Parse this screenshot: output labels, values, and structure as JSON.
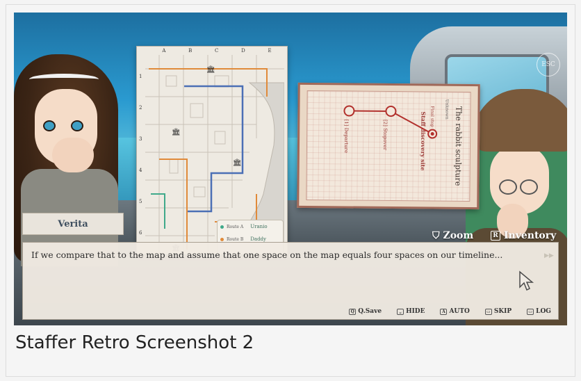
{
  "esc_label": "ESC",
  "map": {
    "columns": [
      "A",
      "B",
      "C",
      "D",
      "E"
    ],
    "rows": [
      "1",
      "2",
      "3",
      "4",
      "5",
      "6"
    ],
    "legend": [
      {
        "label": "Route A",
        "name": "Uranio",
        "color": "#3fa98a"
      },
      {
        "label": "Route B",
        "name": "Daddy",
        "color": "#e08a3a"
      }
    ]
  },
  "notebook": {
    "title": "The rabbit sculpture",
    "final_stop": "Final stop",
    "staff_site": "Staff discovery site",
    "departure": "[1] Departure",
    "stopover": "[2] Stopover",
    "unknown": "Unknown"
  },
  "speaker": "Verita",
  "menu": {
    "zoom": "Zoom",
    "inventory_key": "R",
    "inventory": "Inventory"
  },
  "dialog_text": "If we compare that to the map and assume that one space on the map equals four spaces on our timeline...",
  "bottom_menu": {
    "qsave": "Q.Save",
    "qsave_key": "Q",
    "hide": "HIDE",
    "auto": "AUTO",
    "auto_key": "A",
    "skip": "SKIP",
    "log": "LOG"
  },
  "caption": "Staffer Retro Screenshot 2",
  "colors": {
    "route_blue": "#4b6fb5",
    "route_orange": "#e08a3a",
    "route_green": "#3fa98a",
    "note_red": "#b2302c"
  }
}
